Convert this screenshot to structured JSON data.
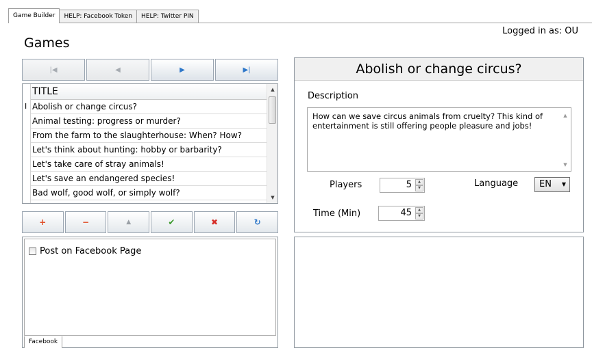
{
  "tabs": [
    "Game Builder",
    "HELP: Facebook Token",
    "HELP: Twitter PIN"
  ],
  "logged_in": "Logged in as: OU",
  "games_title": "Games",
  "navigator": [
    {
      "icon": "first-record-icon",
      "glyph": "|◀"
    },
    {
      "icon": "prior-record-icon",
      "glyph": "◀"
    },
    {
      "icon": "next-record-icon",
      "glyph": "▶"
    },
    {
      "icon": "last-record-icon",
      "glyph": "▶|"
    }
  ],
  "grid": {
    "column": "TITLE",
    "current_marker": "I",
    "rows": [
      "Abolish or change circus?",
      "Animal testing: progress or murder?",
      "From the farm to the slaughterhouse: When? How?",
      "Let's think about hunting: hobby or barbarity?",
      "Let's take care of stray animals!",
      "Let's save an endangered species!",
      "Bad wolf, good wolf, or simply wolf?"
    ]
  },
  "actions": [
    {
      "icon": "insert-icon",
      "glyph": "+",
      "color": "#e0502a"
    },
    {
      "icon": "delete-icon",
      "glyph": "−",
      "color": "#e0502a"
    },
    {
      "icon": "edit-icon",
      "glyph": "▲",
      "color": "#9aa0a6"
    },
    {
      "icon": "post-icon",
      "glyph": "✔",
      "color": "#3c9a2d"
    },
    {
      "icon": "cancel-icon",
      "glyph": "✖",
      "color": "#d6302a"
    },
    {
      "icon": "refresh-icon",
      "glyph": "↻",
      "color": "#2f78c9"
    }
  ],
  "facebook": {
    "checkbox_label": "Post on Facebook Page",
    "tab": "Facebook"
  },
  "detail": {
    "title": "Abolish or change circus?",
    "description_label": "Description",
    "description": "How can we save circus animals from cruelty? This kind of entertainment is still offering people pleasure and jobs!",
    "players_label": "Players",
    "players": "5",
    "language_label": "Language",
    "language": "EN",
    "time_label": "Time (Min)",
    "time": "45"
  }
}
